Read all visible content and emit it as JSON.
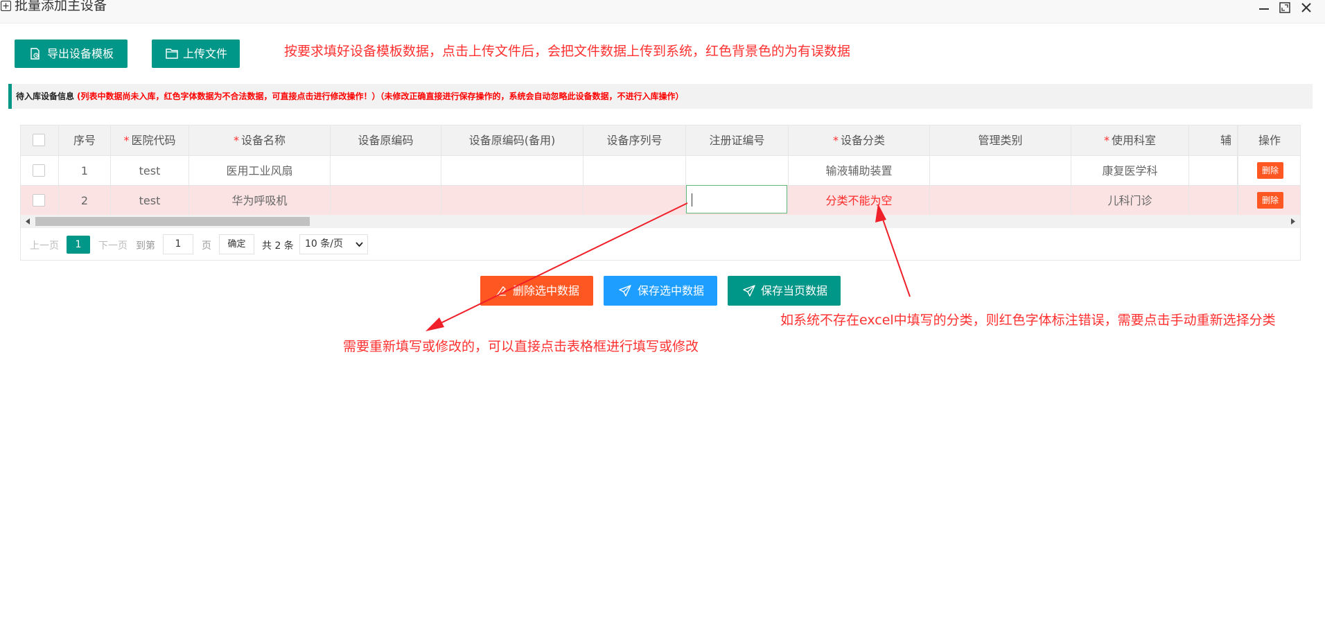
{
  "window": {
    "title": "批量添加主设备",
    "icons": [
      "plus-square-icon",
      "minimize-icon",
      "maximize-icon",
      "close-icon"
    ]
  },
  "toolbar": {
    "export_label": "导出设备模板",
    "upload_label": "上传文件",
    "hint": "按要求填好设备模板数据，点击上传文件后，会把文件数据上传到系统，红色背景色的为有误数据"
  },
  "info": {
    "title": "待入库设备信息",
    "note": "(列表中数据尚未入库，红色字体数据为不合法数据，可直接点击进行修改操作！）（未修改正确直接进行保存操作的，系统会自动忽略此设备数据，不进行入库操作）"
  },
  "table": {
    "columns": [
      {
        "label": "序号",
        "required": false
      },
      {
        "label": "医院代码",
        "required": true
      },
      {
        "label": "设备名称",
        "required": true
      },
      {
        "label": "设备原编码",
        "required": false
      },
      {
        "label": "设备原编码(备用)",
        "required": false
      },
      {
        "label": "设备序列号",
        "required": false
      },
      {
        "label": "注册证编号",
        "required": false
      },
      {
        "label": "设备分类",
        "required": true
      },
      {
        "label": "管理类别",
        "required": false
      },
      {
        "label": "使用科室",
        "required": true
      },
      {
        "label": "辅",
        "required": false
      },
      {
        "label": "操作",
        "required": false
      }
    ],
    "required_mark": "*",
    "rows": [
      {
        "index": "1",
        "hospital_code": "test",
        "device_name": "医用工业风扇",
        "orig_code": "",
        "orig_code_backup": "",
        "serial": "",
        "reg_no": "",
        "category": "输液辅助装置",
        "mgmt_class": "",
        "department": "康复医学科",
        "aux": "",
        "delete_label": "删除",
        "invalid": false
      },
      {
        "index": "2",
        "hospital_code": "test",
        "device_name": "华为呼吸机",
        "orig_code": "",
        "orig_code_backup": "",
        "serial": "",
        "reg_no": "",
        "category": "分类不能为空",
        "mgmt_class": "",
        "department": "儿科门诊",
        "aux": "",
        "delete_label": "删除",
        "invalid": true
      }
    ]
  },
  "pager": {
    "prev": "上一页",
    "current": "1",
    "next": "下一页",
    "goto_label": "到第",
    "goto_value": "1",
    "page_unit": "页",
    "confirm": "确定",
    "total": "共 2 条",
    "page_size": "10 条/页"
  },
  "actions": {
    "delete_selected": "删除选中数据",
    "save_selected": "保存选中数据",
    "save_page": "保存当页数据"
  },
  "annotations": {
    "edit_hint": "需要重新填写或修改的，可以直接点击表格框进行填写或修改",
    "category_hint": "如系统不存在excel中填写的分类，则红色字体标注错误，需要点击手动重新选择分类"
  },
  "colors": {
    "primary": "#009688",
    "blue": "#1e9fff",
    "danger": "#ff5722",
    "error_text": "#ff2a2a",
    "error_row": "#fbe3e3"
  }
}
